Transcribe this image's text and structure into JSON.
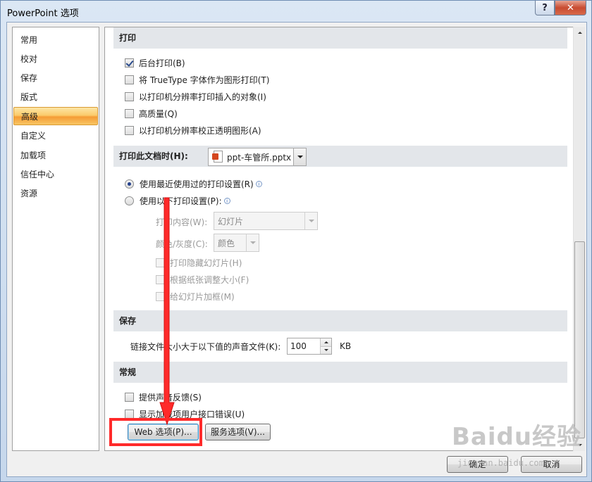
{
  "window": {
    "title": "PowerPoint 选项",
    "help_label": "?",
    "close_label": "✕"
  },
  "nav": {
    "items": [
      {
        "label": "常用"
      },
      {
        "label": "校对"
      },
      {
        "label": "保存"
      },
      {
        "label": "版式"
      },
      {
        "label": "高级"
      },
      {
        "label": "自定义"
      },
      {
        "label": "加载项"
      },
      {
        "label": "信任中心"
      },
      {
        "label": "资源"
      }
    ],
    "active": "高级"
  },
  "print_section": {
    "header": "打印",
    "options": [
      {
        "label": "后台打印(B)",
        "checked": true
      },
      {
        "label": "将 TrueType 字体作为图形打印(T)",
        "checked": false
      },
      {
        "label": "以打印机分辨率打印插入的对象(I)",
        "checked": false
      },
      {
        "label": "高质量(Q)",
        "checked": false
      },
      {
        "label": "以打印机分辨率校正透明图形(A)",
        "checked": false
      }
    ]
  },
  "print_doc_section": {
    "header": "打印此文档时(H):",
    "document": "ppt-车管所.pptx",
    "radio_recent": "使用最近使用过的打印设置(R)",
    "radio_custom": "使用以下打印设置(P):",
    "content_label": "打印内容(W):",
    "content_value": "幻灯片",
    "color_label": "颜色/灰度(C):",
    "color_value": "颜色",
    "sub_options": [
      {
        "label": "打印隐藏幻灯片(H)"
      },
      {
        "label": "根据纸张调整大小(F)"
      },
      {
        "label": "给幻灯片加框(M)"
      }
    ]
  },
  "save_section": {
    "header": "保存",
    "sound_label": "链接文件大小大于以下值的声音文件(K):",
    "sound_value": "100",
    "sound_unit": "KB"
  },
  "general_section": {
    "header": "常规",
    "options": [
      {
        "label": "提供声音反馈(S)",
        "checked": false
      },
      {
        "label": "显示加载项用户接口错误(U)",
        "checked": false
      }
    ],
    "web_button": "Web 选项(P)...",
    "service_button": "服务选项(V)..."
  },
  "footer": {
    "ok_label": "确定",
    "cancel_label": "取消"
  },
  "watermark": {
    "brand": "Baidu经验",
    "sub": "jingyan.baidu.com"
  },
  "colors": {
    "annotation_red": "#ff2a2a",
    "active_nav": "#f8c664"
  }
}
